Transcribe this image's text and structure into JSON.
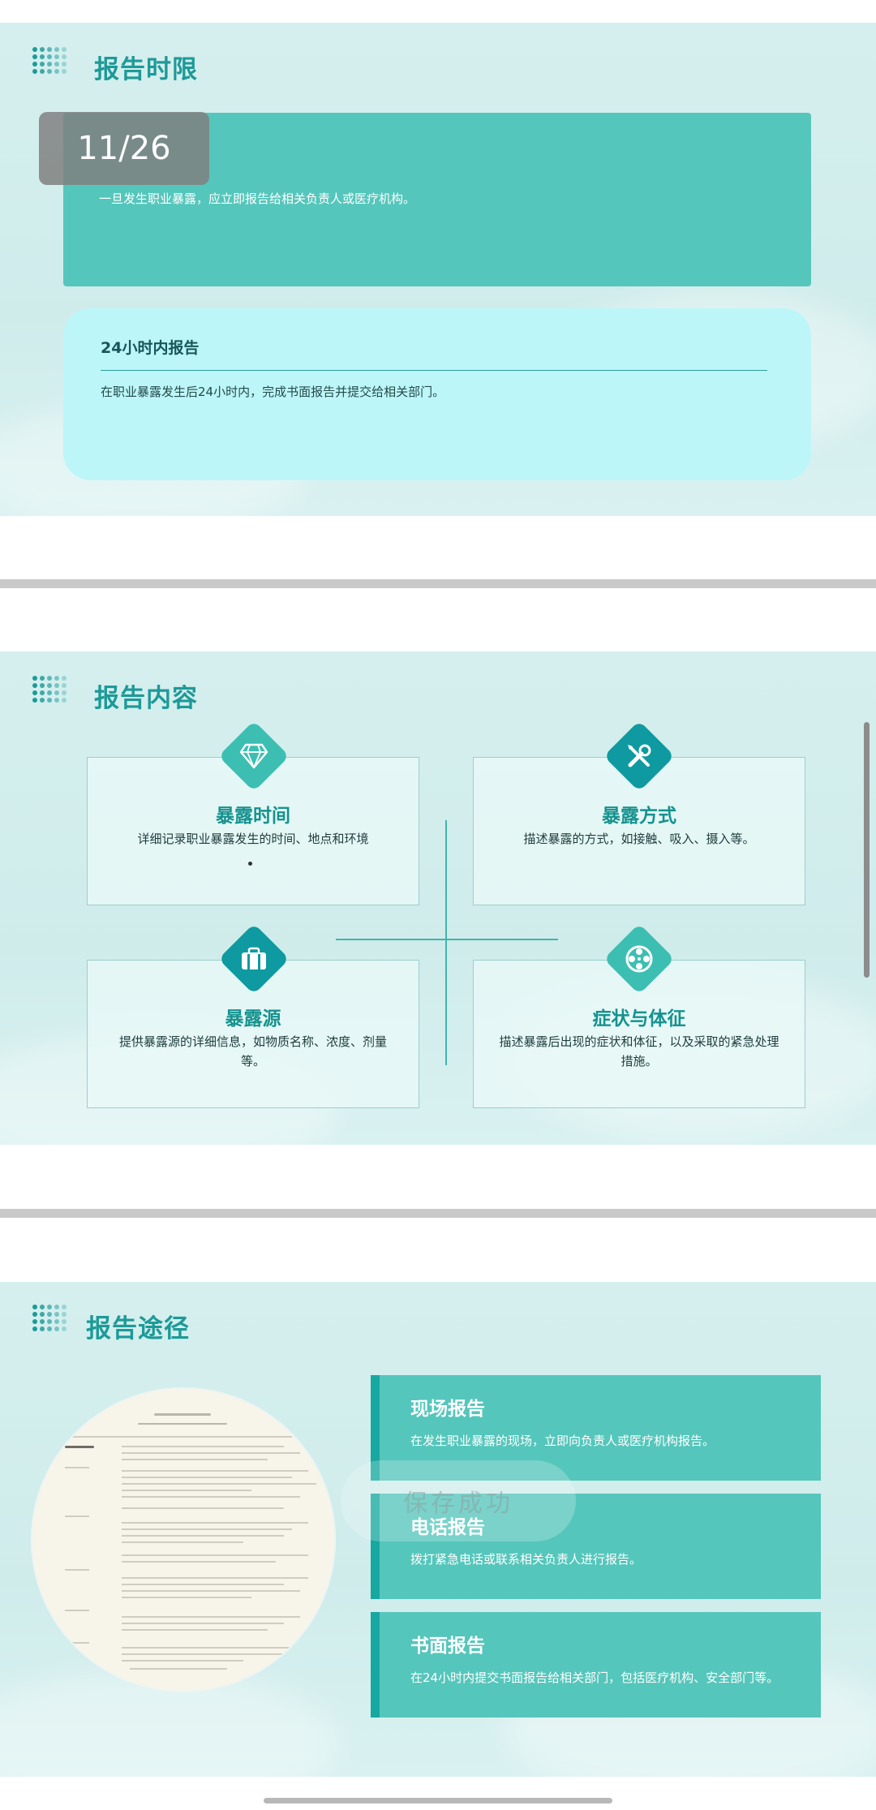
{
  "page_badge": "11/26",
  "slide1": {
    "title": "报告时限",
    "box1_text": "一旦发生职业暴露，应立即报告给相关负责人或医疗机构。",
    "box2_title": "24小时内报告",
    "box2_text": "在职业暴露发生后24小时内，完成书面报告并提交给相关部门。"
  },
  "slide2": {
    "title": "报告内容",
    "cards": [
      {
        "title": "暴露时间",
        "desc": "详细记录职业暴露发生的时间、地点和环境",
        "icon": "diamond-gem-icon"
      },
      {
        "title": "暴露方式",
        "desc": "描述暴露的方式，如接触、吸入、摄入等。",
        "icon": "tools-icon"
      },
      {
        "title": "暴露源",
        "desc": "提供暴露源的详细信息，如物质名称、浓度、剂量等。",
        "icon": "briefcase-icon"
      },
      {
        "title": "症状与体征",
        "desc": "描述暴露后出现的症状和体征，以及采取的紧急处理措施。",
        "icon": "film-reel-icon"
      }
    ]
  },
  "slide3": {
    "title": "报告途径",
    "routes": [
      {
        "title": "现场报告",
        "desc": "在发生职业暴露的现场，立即向负责人或医疗机构报告。"
      },
      {
        "title": "电话报告",
        "desc": "拨打紧急电话或联系相关负责人进行报告。"
      },
      {
        "title": "书面报告",
        "desc": "在24小时内提交书面报告给相关部门，包括医疗机构、安全部门等。"
      }
    ]
  },
  "toast": "保存成功",
  "colors": {
    "accent": "#1d9a98",
    "teal": "#55c6bb",
    "cyan": "#bdf6f8",
    "dark_teal": "#16a8a1"
  }
}
